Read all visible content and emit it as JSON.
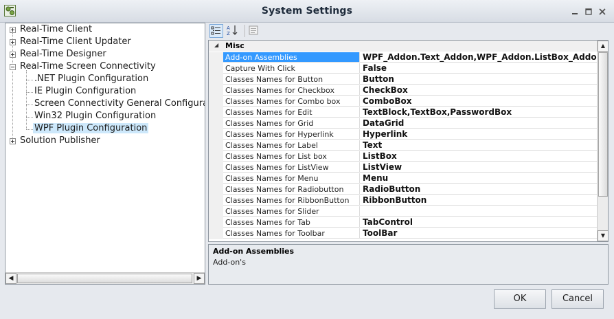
{
  "window": {
    "title": "System Settings"
  },
  "tree": {
    "nodes": [
      {
        "label": "Real-Time Client"
      },
      {
        "label": "Real-Time Client Updater"
      },
      {
        "label": "Real-Time Designer"
      },
      {
        "label": "Real-Time Screen Connectivity"
      },
      {
        "label": ".NET Plugin Configuration"
      },
      {
        "label": "IE Plugin Configuration"
      },
      {
        "label": "Screen Connectivity General Configurat"
      },
      {
        "label": "Win32 Plugin Configuration"
      },
      {
        "label": "WPF Plugin Configuration"
      },
      {
        "label": "Solution Publisher"
      }
    ],
    "selected": "WPF Plugin Configuration"
  },
  "property_grid": {
    "category": "Misc",
    "rows": [
      {
        "name": "Add-on Assemblies",
        "value": "WPF_Addon.Text_Addon,WPF_Addon.ListBox_Addon"
      },
      {
        "name": "Capture With Click",
        "value": "False"
      },
      {
        "name": "Classes Names for Button",
        "value": "Button"
      },
      {
        "name": "Classes Names for Checkbox",
        "value": "CheckBox"
      },
      {
        "name": "Classes Names for Combo box",
        "value": "ComboBox"
      },
      {
        "name": "Classes Names for Edit",
        "value": "TextBlock,TextBox,PasswordBox"
      },
      {
        "name": "Classes Names for Grid",
        "value": "DataGrid"
      },
      {
        "name": "Classes Names for Hyperlink",
        "value": "Hyperlink"
      },
      {
        "name": "Classes Names for Label",
        "value": "Text"
      },
      {
        "name": "Classes Names for List box",
        "value": "ListBox"
      },
      {
        "name": "Classes Names for ListView",
        "value": "ListView"
      },
      {
        "name": "Classes Names for Menu",
        "value": "Menu"
      },
      {
        "name": "Classes Names for Radiobutton",
        "value": "RadioButton"
      },
      {
        "name": "Classes Names for RibbonButton",
        "value": "RibbonButton"
      },
      {
        "name": "Classes Names for Slider",
        "value": ""
      },
      {
        "name": "Classes Names for Tab",
        "value": "TabControl"
      },
      {
        "name": "Classes Names for Toolbar",
        "value": "ToolBar"
      }
    ],
    "selected_row": "Add-on Assemblies"
  },
  "description": {
    "title": "Add-on Assemblies",
    "text": "Add-on's"
  },
  "buttons": {
    "ok": "OK",
    "cancel": "Cancel"
  },
  "colors": {
    "selection": "#3399ff",
    "tree_selection": "#cde8fb"
  }
}
